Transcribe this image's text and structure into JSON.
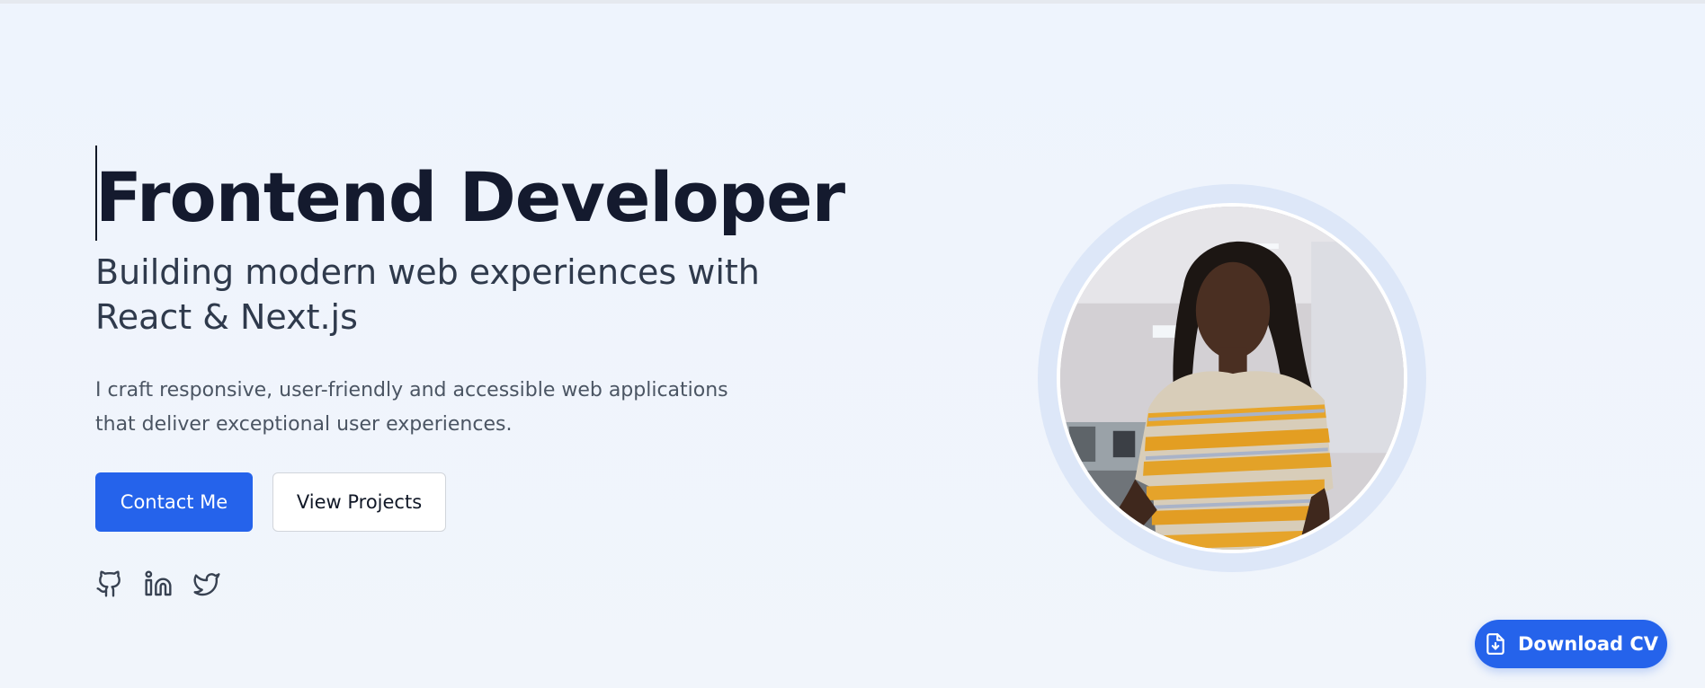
{
  "hero": {
    "title": "Frontend Developer",
    "subtitle": "Building modern web experiences with React & Next.js",
    "description": "I craft responsive, user-friendly and accessible web applications that deliver exceptional user experiences."
  },
  "buttons": {
    "contact_label": "Contact Me",
    "projects_label": "View Projects",
    "download_label": "Download CV"
  },
  "social": {
    "icons": [
      "github-icon",
      "linkedin-icon",
      "twitter-icon"
    ]
  },
  "profile": {
    "photo_icon": "profile-photo"
  },
  "colors": {
    "accent": "#2563eb",
    "heading": "#141a2e",
    "background": "#eef4fd",
    "halo": "#dde7f8"
  }
}
